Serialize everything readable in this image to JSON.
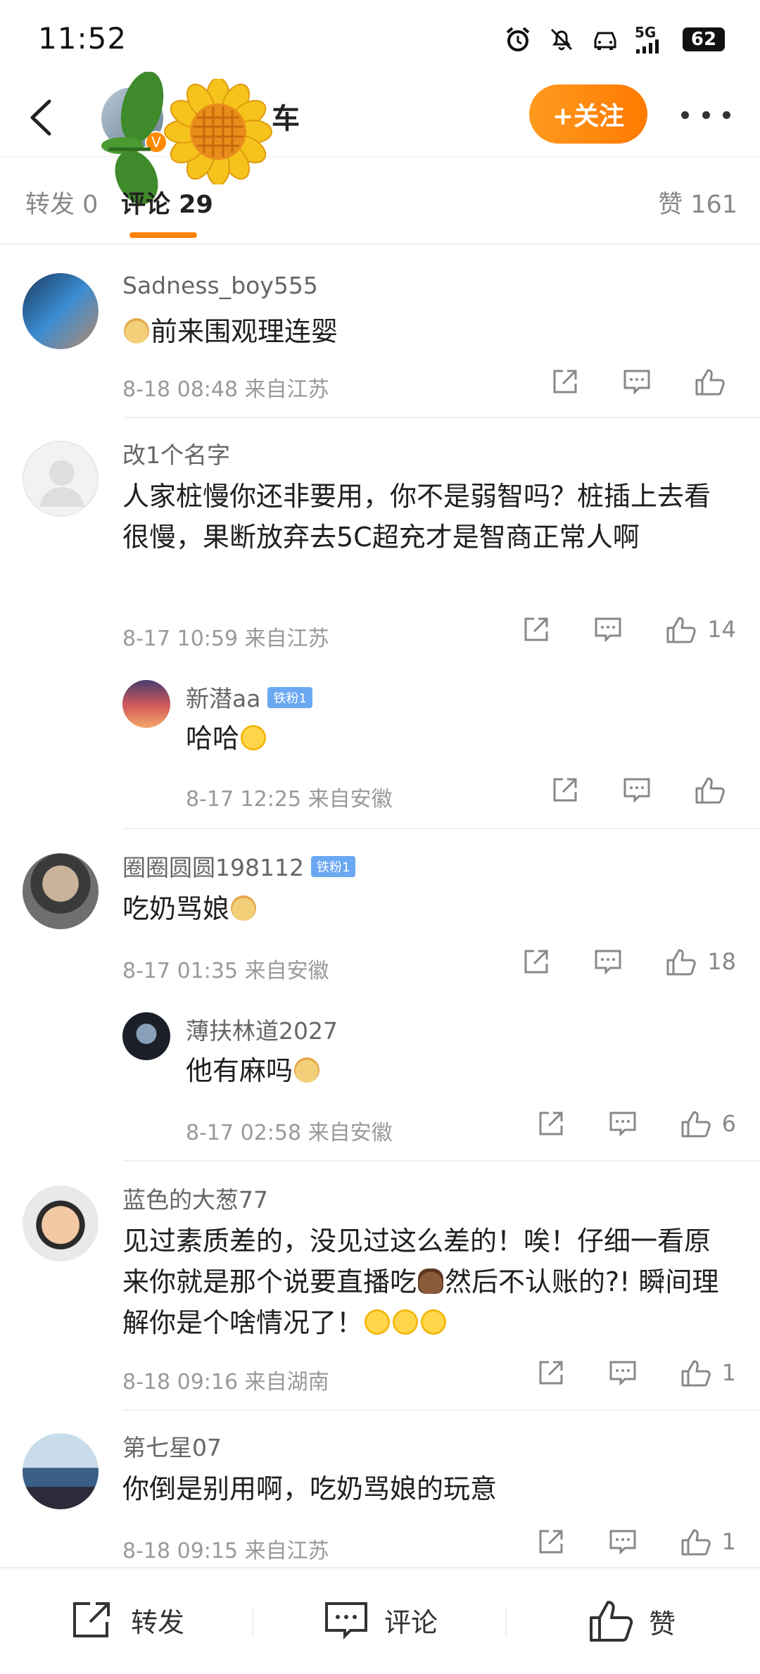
{
  "status_bar": {
    "time": "11:52",
    "network": "5G",
    "battery": "62"
  },
  "header": {
    "title_suffix": "车",
    "follow_label": "+关注"
  },
  "tabs": {
    "repost": "转发 0",
    "comments": "评论 29",
    "likes": "赞 161"
  },
  "comments": [
    {
      "name": "Sadness_boy555",
      "text": "前来围观理连婴",
      "meta": "8-18 08:48  来自江苏",
      "likes": ""
    },
    {
      "name": "改1个名字",
      "text": "人家桩慢你还非要用，你不是弱智吗？桩插上去看很慢，果断放弃去5C超充才是智商正常人啊",
      "meta": "8-17 10:59  来自江苏",
      "likes": "14"
    },
    {
      "name": "新潜aa",
      "badge": "铁粉1",
      "text": "哈哈",
      "meta": "8-17 12:25  来自安徽",
      "likes": ""
    },
    {
      "name": "圈圈圆圆198112",
      "badge": "铁粉1",
      "text": "吃奶骂娘",
      "meta": "8-17 01:35  来自安徽",
      "likes": "18"
    },
    {
      "name": "薄扶林道2027",
      "text": "他有麻吗",
      "meta": "8-17 02:58  来自安徽",
      "likes": "6"
    },
    {
      "name": "蓝色的大葱77",
      "text_1": "见过素质差的，没见过这么差的！唉！仔细一看原来你就是那个说要直播吃",
      "text_2": "然后不认账的?!  瞬间理解你是个啥情况了！",
      "meta": "8-18 09:16  来自湖南",
      "likes": "1"
    },
    {
      "name": "第七星07",
      "text": "你倒是别用啊，吃奶骂娘的玩意",
      "meta": "8-18 09:15  来自江苏",
      "likes": "1"
    }
  ],
  "bottom_bar": {
    "repost": "转发",
    "comment": "评论",
    "like": "赞"
  },
  "colors": {
    "accent": "#ff8200",
    "badge": "#6aa8f2"
  }
}
